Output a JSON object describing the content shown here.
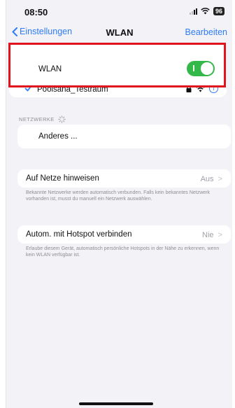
{
  "status_bar": {
    "time": "08:50",
    "battery": "96"
  },
  "nav": {
    "back_label": "Einstellungen",
    "title": "WLAN",
    "edit_label": "Bearbeiten"
  },
  "wlan": {
    "label": "WLAN",
    "enabled": true
  },
  "connected_network": {
    "name": "Poolsana_Testraum"
  },
  "networks_section": {
    "header": "NETZWERKE",
    "other_label": "Anderes ..."
  },
  "ask_join": {
    "label": "Auf Netze hinweisen",
    "value": "Aus",
    "footnote": "Bekannte Netzwerke werden automatisch verbunden. Falls kein bekanntes Netzwerk vorhanden ist, musst du manuell ein Netzwerk auswählen."
  },
  "hotspot": {
    "label": "Autom. mit Hotspot verbinden",
    "value": "Nie",
    "footnote": "Erlaube diesem Gerät, automatisch persönliche Hotspots in der Nähe zu erkennen, wenn kein WLAN verfügbar ist."
  },
  "chevron": ">",
  "icons": {
    "back": "chevron-left-icon",
    "check": "checkmark-icon",
    "lock": "lock-icon",
    "wifi": "wifi-icon",
    "info": "info-icon",
    "spinner": "spinner-icon"
  },
  "colors": {
    "accent": "#2f7cf6",
    "toggle_on": "#34b84a",
    "highlight": "#e0141c"
  }
}
